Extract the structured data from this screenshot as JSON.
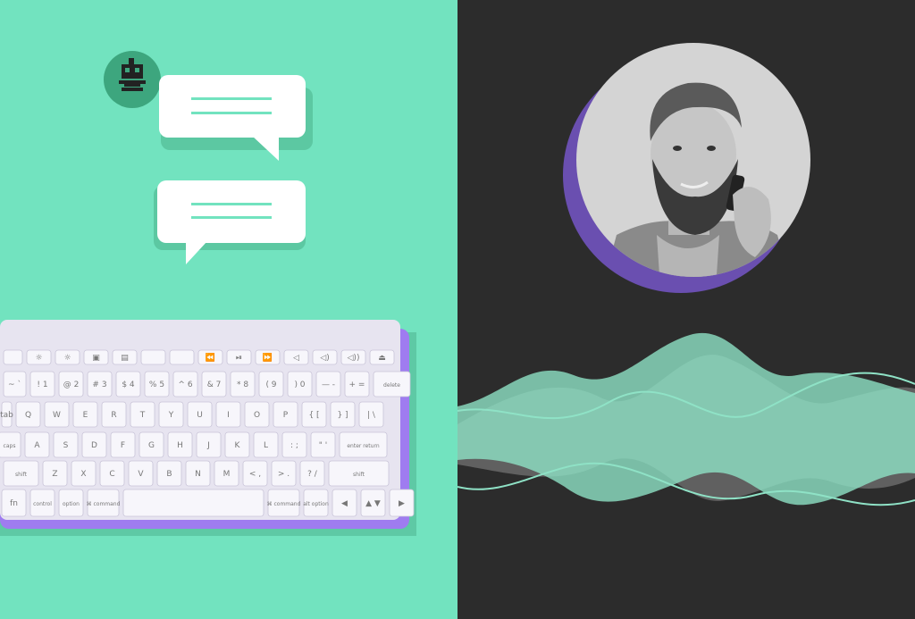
{
  "colors": {
    "mint_background": "#72e3bf",
    "dark_background": "#2c2c2c",
    "bubble_fill": "#ffffff",
    "bubble_line": "#72e3bf",
    "robot_avatar": "#3da67e",
    "keyboard_accent": "#9f7cf0",
    "wave_mint": "#8fe2c6",
    "wave_grey": "#6a6a6a"
  },
  "icons": {
    "robot": "robot-icon",
    "chat": "chat-bubble-icon"
  },
  "keyboard": {
    "rows": [
      [
        " ",
        "☼",
        "☼",
        "▣",
        "▤",
        " ",
        " ",
        "⏪",
        "⏯",
        "⏩",
        "◁",
        "◁)",
        "◁))",
        "⏏"
      ],
      [
        "~ `",
        "! 1",
        "@ 2",
        "# 3",
        "$ 4",
        "% 5",
        "^ 6",
        "& 7",
        "* 8",
        "( 9",
        ") 0",
        "— -",
        "+ =",
        "delete"
      ],
      [
        "tab",
        "Q",
        "W",
        "E",
        "R",
        "T",
        "Y",
        "U",
        "I",
        "O",
        "P",
        "{ [",
        "} ]",
        "| \\"
      ],
      [
        "caps",
        "A",
        "S",
        "D",
        "F",
        "G",
        "H",
        "J",
        "K",
        "L",
        ": ;",
        "\" '",
        "enter return"
      ],
      [
        "shift",
        "Z",
        "X",
        "C",
        "V",
        "B",
        "N",
        "M",
        "< ,",
        "> .",
        "? /",
        "shift"
      ],
      [
        "fn",
        "control",
        "option",
        "⌘ command",
        "",
        "⌘ command",
        "alt option",
        "◀",
        "▲ ▼",
        "▶"
      ]
    ]
  },
  "photo": {
    "subject": "bearded man on phone"
  }
}
